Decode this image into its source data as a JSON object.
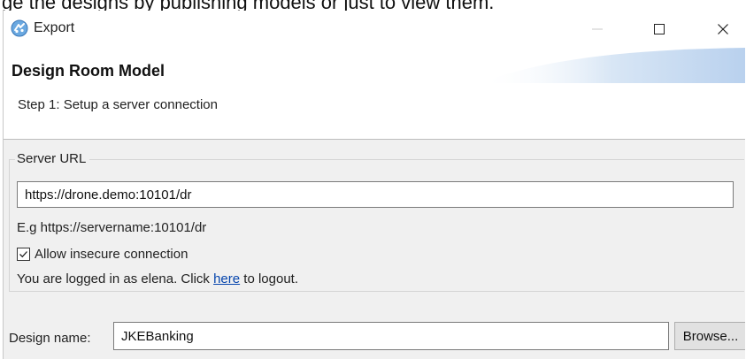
{
  "background": {
    "text": "ge the designs by publishing models or just to view them."
  },
  "window": {
    "title": "Export",
    "icon": "export-wizard-icon",
    "controls": {
      "minimize": "minimize-icon",
      "maximize": "maximize-icon",
      "close": "close-icon"
    }
  },
  "header": {
    "title": "Design Room Model",
    "step": "Step 1: Setup a server connection"
  },
  "server_group": {
    "legend": "Server URL",
    "url_value": "https://drone.demo:10101/dr",
    "hint": "E.g https://servername:10101/dr",
    "insecure": {
      "label": "Allow insecure connection",
      "checked": true
    },
    "login": {
      "prefix": "You are logged in as elena. Click ",
      "link": "here",
      "suffix": " to logout."
    }
  },
  "design": {
    "label": "Design name:",
    "value": "JKEBanking",
    "browse_label": "Browse..."
  },
  "colors": {
    "body_background": "#f0f0f0",
    "link": "#0645ad"
  }
}
